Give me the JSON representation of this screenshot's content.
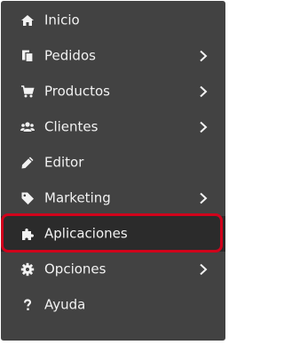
{
  "menu": {
    "items": [
      {
        "label": "Inicio",
        "icon": "home-icon",
        "has_submenu": false
      },
      {
        "label": "Pedidos",
        "icon": "orders-icon",
        "has_submenu": true
      },
      {
        "label": "Productos",
        "icon": "cart-icon",
        "has_submenu": true
      },
      {
        "label": "Clientes",
        "icon": "users-icon",
        "has_submenu": true
      },
      {
        "label": "Editor",
        "icon": "pencil-icon",
        "has_submenu": false
      },
      {
        "label": "Marketing",
        "icon": "tag-icon",
        "has_submenu": true
      },
      {
        "label": "Aplicaciones",
        "icon": "puzzle-icon",
        "has_submenu": false,
        "selected": true
      },
      {
        "label": "Opciones",
        "icon": "gear-icon",
        "has_submenu": true
      },
      {
        "label": "Ayuda",
        "icon": "question-icon",
        "has_submenu": false
      }
    ]
  },
  "colors": {
    "background": "#424242",
    "text": "#f2f2f2",
    "active_background": "#2b2b2b",
    "highlight_border": "#d0021b"
  }
}
